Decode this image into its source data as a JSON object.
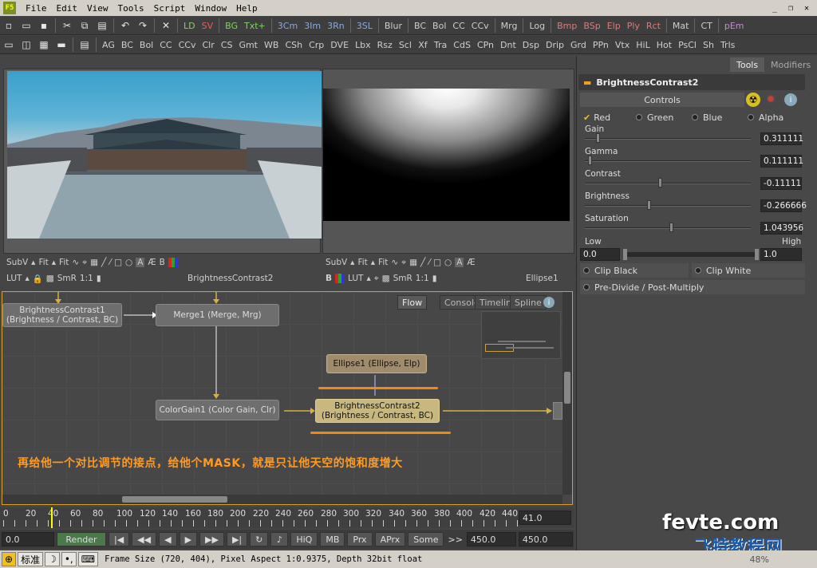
{
  "menu": {
    "logo": "F5",
    "items": [
      "File",
      "Edit",
      "View",
      "Tools",
      "Script",
      "Window",
      "Help"
    ]
  },
  "toolbar1": [
    "LD",
    "SV",
    "BG",
    "Txt+",
    "3Cm",
    "3Im",
    "3Rn",
    "3SL",
    "Blur",
    "BC",
    "Bol",
    "CC",
    "CCv",
    "Mrg",
    "Log",
    "Bmp",
    "BSp",
    "Elp",
    "Ply",
    "Rct",
    "Mat",
    "CT",
    "pEm"
  ],
  "toolbar2": [
    "AG",
    "BC",
    "Bol",
    "CC",
    "CCv",
    "Clr",
    "CS",
    "Gmt",
    "WB",
    "CSh",
    "Crp",
    "DVE",
    "Lbx",
    "Rsz",
    "Scl",
    "Xf",
    "Tra",
    "CdS",
    "CPn",
    "Dnt",
    "Dsp",
    "Drip",
    "Grd",
    "PPn",
    "Vtx",
    "HiL",
    "Hot",
    "PsCl",
    "Sh",
    "Trls"
  ],
  "colors": {
    "ld": "#7fd45a",
    "sv": "#e06060",
    "bg": "#7fd45a",
    "txt": "#7fd45a",
    "three": "#8aa8e0",
    "mask": "#e07a7a",
    "mat": "#d8d8d8",
    "accent": "#f08a14",
    "flowBorder": "#d8a020"
  },
  "viewer1": {
    "row1": [
      "SubV",
      "Fit",
      "Fit"
    ],
    "row2": [
      "LUT",
      "SmR",
      "1:1"
    ],
    "name": "BrightnessContrast2"
  },
  "viewer2": {
    "row1": [
      "SubV",
      "Fit",
      "Fit"
    ],
    "row2": [
      "B",
      "LUT",
      "SmR",
      "1:1"
    ],
    "name": "Ellipse1"
  },
  "viewer_controls": [
    "A",
    "B"
  ],
  "flow": {
    "tabs": [
      "Flow",
      "Console",
      "Timeline",
      "Spline"
    ],
    "nodes": {
      "bc1": {
        "name": "BrightnessContrast1",
        "sub": "(Brightness / Contrast, BC)"
      },
      "merge": {
        "name": "Merge1  (Merge, Mrg)"
      },
      "ellipse": {
        "name": "Ellipse1  (Ellipse, Elp)"
      },
      "colorgain": {
        "name": "ColorGain1  (Color Gain, Clr)"
      },
      "bc2": {
        "name": "BrightnessContrast2",
        "sub": "(Brightness / Contrast, BC)"
      }
    },
    "annotation": "再给他一个对比调节的接点，给他个MASK，就是只让他天空的饱和度增大"
  },
  "timeline": {
    "ticks": [
      "0",
      "20",
      "40",
      "60",
      "80",
      "100",
      "120",
      "140",
      "160",
      "180",
      "200",
      "220",
      "240",
      "260",
      "280",
      "300",
      "320",
      "340",
      "360",
      "380",
      "400",
      "420",
      "440"
    ],
    "current": "41.0"
  },
  "controls": {
    "start": "0.0",
    "render": "Render",
    "hiq": "HiQ",
    "mb": "MB",
    "prx": "Prx",
    "aprx": "APrx",
    "some": "Some",
    "arrows": ">>",
    "end1": "450.0",
    "end2": "450.0"
  },
  "status": {
    "ime": [
      "标准"
    ],
    "text": "Frame Size (720, 404), Pixel Aspect 1:0.9375, Depth 32bit float",
    "zoom": "48%"
  },
  "panel": {
    "tabs": [
      "Tools",
      "Modifiers"
    ],
    "tool": "BrightnessContrast2",
    "section": "Controls",
    "channels": [
      "Red",
      "Green",
      "Blue",
      "Alpha"
    ],
    "sliders": [
      {
        "label": "Gain",
        "value": "0.311111",
        "pos": 0.07
      },
      {
        "label": "Gamma",
        "value": "0.111111",
        "pos": 0.02
      },
      {
        "label": "Contrast",
        "value": "-0.11111",
        "pos": 0.45
      },
      {
        "label": "Brightness",
        "value": "-0.266666",
        "pos": 0.38
      },
      {
        "label": "Saturation",
        "value": "1.043956",
        "pos": 0.52
      }
    ],
    "low": "Low",
    "high": "High",
    "lowval": "0.0",
    "highval": "1.0",
    "clip_black": "Clip Black",
    "clip_white": "Clip White",
    "predivide": "Pre-Divide / Post-Multiply"
  },
  "watermark": {
    "line1": "fevte.com",
    "line2": "飞特教程网"
  }
}
